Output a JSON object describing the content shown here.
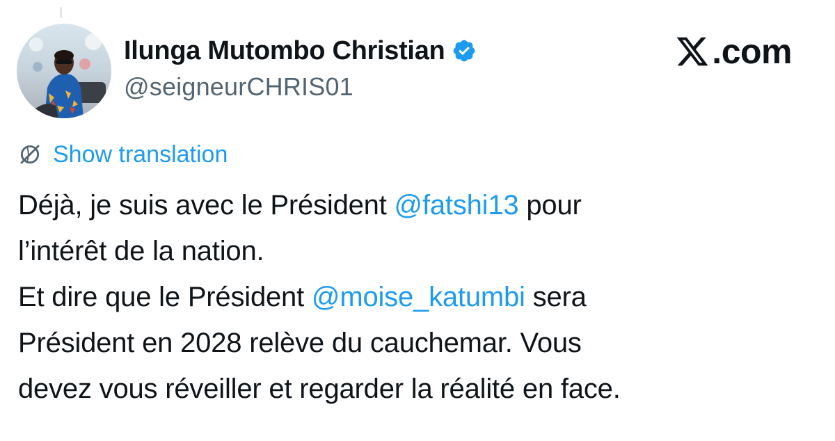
{
  "author": {
    "display_name": "Ilunga Mutombo Christian",
    "handle": "@seigneurCHRIS01",
    "verified": true,
    "avatar_icon": "profile-photo"
  },
  "brand": {
    "logo_icon": "x-logo-icon",
    "suffix": ".com"
  },
  "translation": {
    "icon": "globe-icon",
    "label": "Show translation"
  },
  "tweet": {
    "lines": [
      {
        "before": "Déjà, je suis avec le Président ",
        "mention": "@fatshi13",
        "after": " pour"
      },
      {
        "before": "l’intérêt de la nation.",
        "mention": "",
        "after": ""
      },
      {
        "before": "Et dire que le Président ",
        "mention": "@moise_katumbi",
        "after": " sera"
      },
      {
        "before": "Président en 2028 relève du cauchemar. Vous",
        "mention": "",
        "after": ""
      },
      {
        "before": "devez vous réveiller et regarder la réalité en face.",
        "mention": "",
        "after": ""
      }
    ]
  },
  "colors": {
    "link": "#1d9bf0",
    "text": "#0f1419",
    "secondary": "#536471",
    "verified": "#1d9bf0"
  }
}
